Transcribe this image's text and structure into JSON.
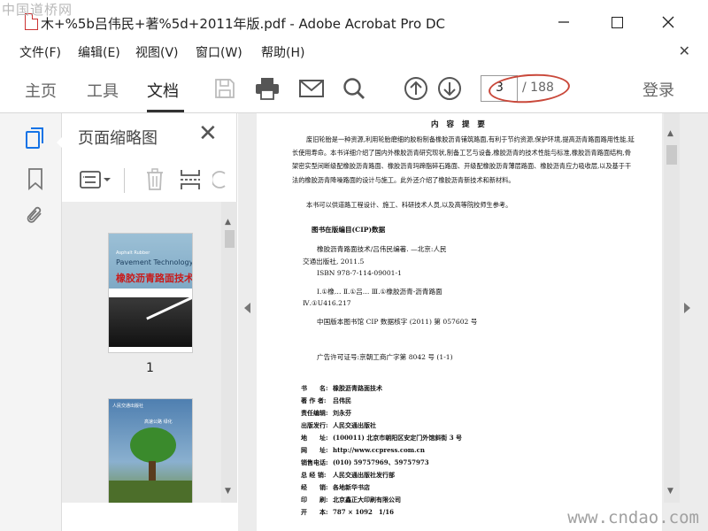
{
  "watermark": {
    "top_left": "中国道桥网",
    "bottom_right": "www.cndao.com"
  },
  "window": {
    "title": "木+%5b吕伟民+著%5d+2011年版.pdf - Adobe Acrobat Pro DC"
  },
  "menu": [
    "文件(F)",
    "编辑(E)",
    "视图(V)",
    "窗口(W)",
    "帮助(H)"
  ],
  "tabs": {
    "home": "主页",
    "tools": "工具",
    "document": "文档"
  },
  "page_nav": {
    "current": "3",
    "total": "/ 188"
  },
  "login": "登录",
  "thumbnails": {
    "title": "页面缩略图",
    "items": [
      {
        "label": "1",
        "cover_en_small": "Asphalt Rubber",
        "cover_en": "Pavement Technology",
        "cover_cn": "橡胶沥青路面技术"
      },
      {
        "label": "",
        "cover_small": "人民交通出版社",
        "cover_text": "高速公路 绿化"
      }
    ]
  },
  "document": {
    "heading": "内 容 提 要",
    "summary_1": "废旧轮胎是一种资源,利用轮胎磨细的胶粉制备橡胶沥青铺筑路面,有利于节约资源,保护环境,提高沥青路面路用性能,延长使用寿命。本书详细介绍了国内外橡胶沥青研究现状,制备工艺与设备,橡胶沥青的技术性能与标准,橡胶沥青路面结构,骨架密实型间断级配橡胶沥青路面、橡胶沥青玛蹄脂碎石路面、开级配橡胶沥青薄层路面、橡胶沥青应力吸收层,以及基于干法的橡胶沥青降噪路面的设计与施工。此外还介绍了橡胶沥青新技术和新材料。",
    "summary_2": "本书可以供道路工程设计、施工、科研技术人员,以及高等院校师生参考。",
    "cip_heading": "图书在版编目(CIP)数据",
    "cip_line1": "橡胶沥青路面技术/吕伟民编著. —北京:人民",
    "cip_line2": "交通出版社, 2011.5",
    "cip_isbn": "ISBN 978-7-114-09001-1",
    "cip_class1": "Ⅰ.①橡… Ⅱ.①吕… Ⅲ.①橡胶沥青-沥青路面",
    "cip_class2": "Ⅳ.①U416.217",
    "cip_core": "中国版本图书馆 CIP 数据核字 (2011) 第 057602 号",
    "license": "广告许可证号:京朝工商广字第 8042 号 (1-1)",
    "info": [
      {
        "k": "书　　名:",
        "v": "橡胶沥青路面技术"
      },
      {
        "k": "著 作 者:",
        "v": "吕伟民"
      },
      {
        "k": "责任编辑:",
        "v": "刘永芬"
      },
      {
        "k": "出版发行:",
        "v": "人民交通出版社"
      },
      {
        "k": "地　　址:",
        "v": "(100011) 北京市朝阳区安定门外馆斜街 3 号"
      },
      {
        "k": "网　　址:",
        "v": "http://www.ccpress.com.cn"
      },
      {
        "k": "销售电话:",
        "v": "(010) 59757969、59757973"
      },
      {
        "k": "总 经 销:",
        "v": "人民交通出版社发行部"
      },
      {
        "k": "经　　销:",
        "v": "各地新华书店"
      },
      {
        "k": "印　　刷:",
        "v": "北京鑫正大印刷有限公司"
      },
      {
        "k": "开　　本:",
        "v": "787 × 1092　1/16"
      }
    ]
  },
  "colors": {
    "annotation_ellipse": "#c9483a",
    "active_rail_icon": "#1473e6"
  }
}
